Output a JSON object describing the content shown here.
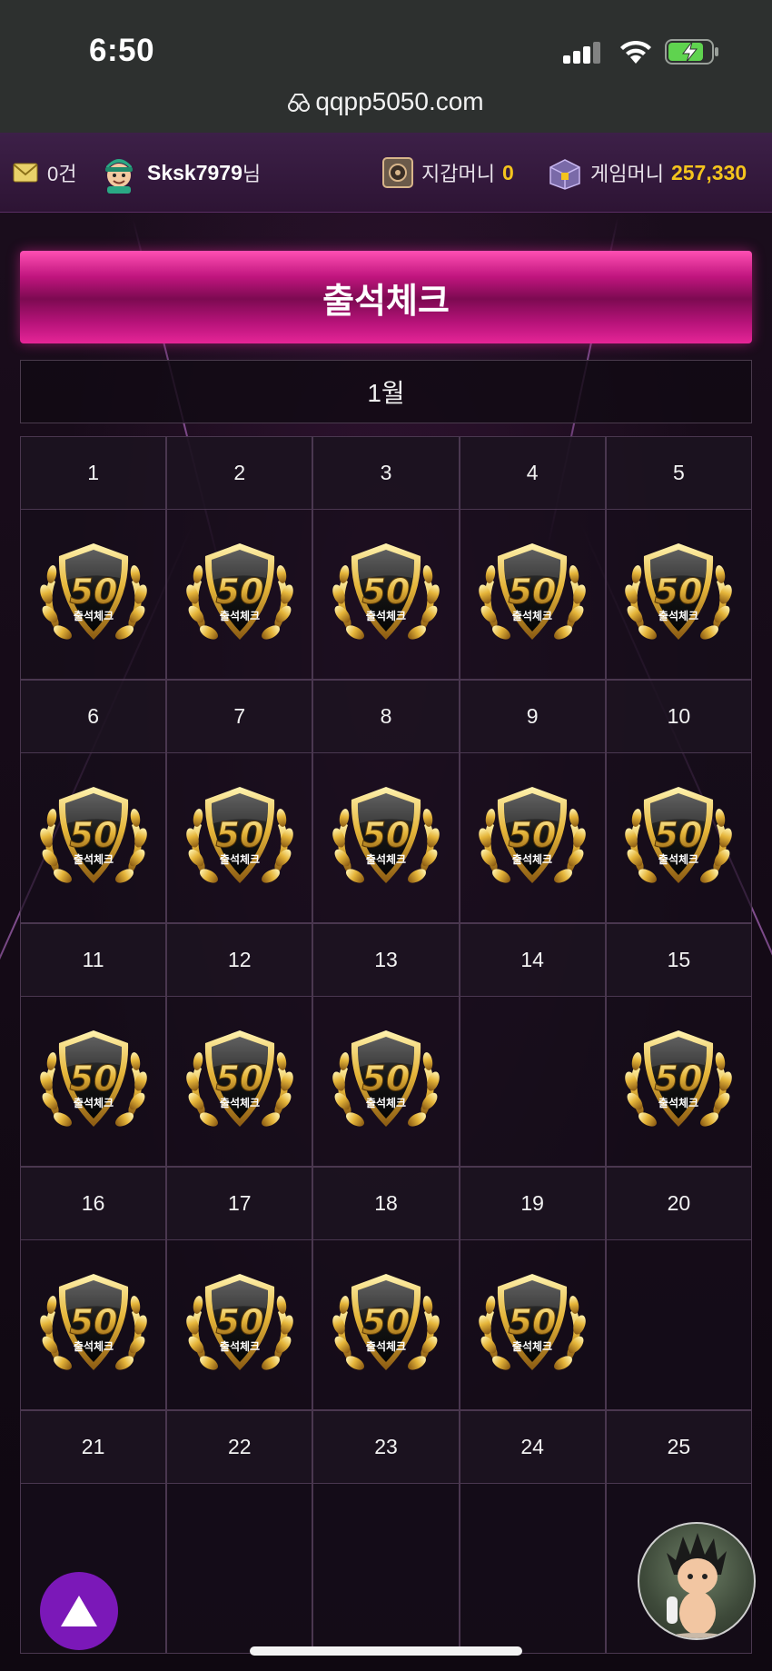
{
  "status_bar": {
    "time": "6:50"
  },
  "browser": {
    "url": "qqpp5050.com"
  },
  "topbar": {
    "messages": "0건",
    "username": "Sksk7979",
    "username_suffix": "님",
    "wallet_label": "지갑머니",
    "wallet_value": "0",
    "game_label": "게임머니",
    "game_value": "257,330"
  },
  "page": {
    "title": "출석체크",
    "month": "1월"
  },
  "stamp": {
    "amount": "50",
    "label": "출석체크"
  },
  "calendar": [
    {
      "day": "1",
      "checked": true
    },
    {
      "day": "2",
      "checked": true
    },
    {
      "day": "3",
      "checked": true
    },
    {
      "day": "4",
      "checked": true
    },
    {
      "day": "5",
      "checked": true
    },
    {
      "day": "6",
      "checked": true
    },
    {
      "day": "7",
      "checked": true
    },
    {
      "day": "8",
      "checked": true
    },
    {
      "day": "9",
      "checked": true
    },
    {
      "day": "10",
      "checked": true
    },
    {
      "day": "11",
      "checked": true
    },
    {
      "day": "12",
      "checked": true
    },
    {
      "day": "13",
      "checked": true
    },
    {
      "day": "14",
      "checked": false
    },
    {
      "day": "15",
      "checked": true
    },
    {
      "day": "16",
      "checked": true
    },
    {
      "day": "17",
      "checked": true
    },
    {
      "day": "18",
      "checked": true
    },
    {
      "day": "19",
      "checked": true
    },
    {
      "day": "20",
      "checked": false
    },
    {
      "day": "21",
      "checked": false
    },
    {
      "day": "22",
      "checked": false
    },
    {
      "day": "23",
      "checked": false
    },
    {
      "day": "24",
      "checked": false
    },
    {
      "day": "25",
      "checked": false
    }
  ],
  "colors": {
    "accent_pink": "#c0157e",
    "gold": "#f4c41d",
    "scroll_button": "#7b18b8"
  }
}
